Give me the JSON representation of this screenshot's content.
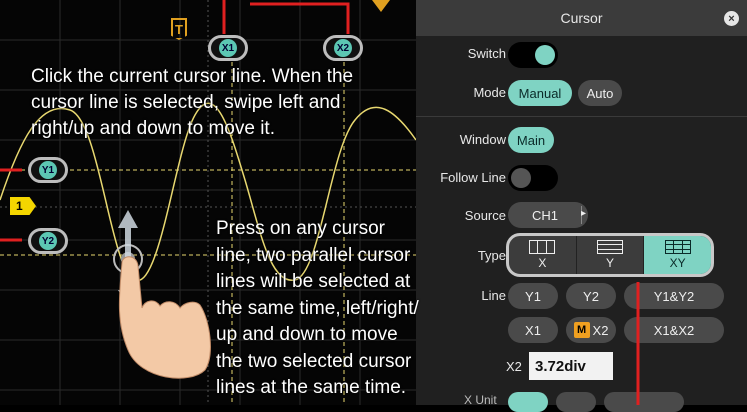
{
  "scope": {
    "trigger_marker": "T",
    "channel_marker": "1",
    "cursor_x1": "X1",
    "cursor_x2": "X2",
    "cursor_y1": "Y1",
    "cursor_y2": "Y2",
    "instruction_top": [
      "Click the current cursor line. When the",
      "cursor line is selected, swipe left and",
      "right/up and down to move it."
    ],
    "instruction_bottom": [
      "Press on any cursor",
      "line, two parallel cursor",
      "lines will be selected at",
      "the same time, left/right/",
      "up and down to move",
      "the two selected cursor",
      "lines at the same time."
    ]
  },
  "panel": {
    "title": "Cursor",
    "close_icon": "close-icon",
    "switch_label": "Switch",
    "switch_on": true,
    "mode_label": "Mode",
    "mode_options": [
      "Manual",
      "Auto"
    ],
    "mode_selected": "Manual",
    "window_label": "Window",
    "window_value": "Main",
    "follow_line_label": "Follow Line",
    "follow_line_on": false,
    "source_label": "Source",
    "source_value": "CH1",
    "type_label": "Type",
    "type_options": [
      "X",
      "Y",
      "XY"
    ],
    "type_selected": "XY",
    "line_label": "Line",
    "line_options_row1": [
      "Y1",
      "Y2",
      "Y1&Y2"
    ],
    "line_options_row2": [
      "X1",
      "X2",
      "X1&X2"
    ],
    "line_selected": "X2",
    "line_selected_badge": "M",
    "x2_label": "X2",
    "x2_value": "3.72div",
    "x_unit_label": "X Unit"
  },
  "colors": {
    "accent": "#7fd3c3",
    "panel_bg": "#202020",
    "trace": "#e8d870",
    "annotation": "#e02020"
  }
}
